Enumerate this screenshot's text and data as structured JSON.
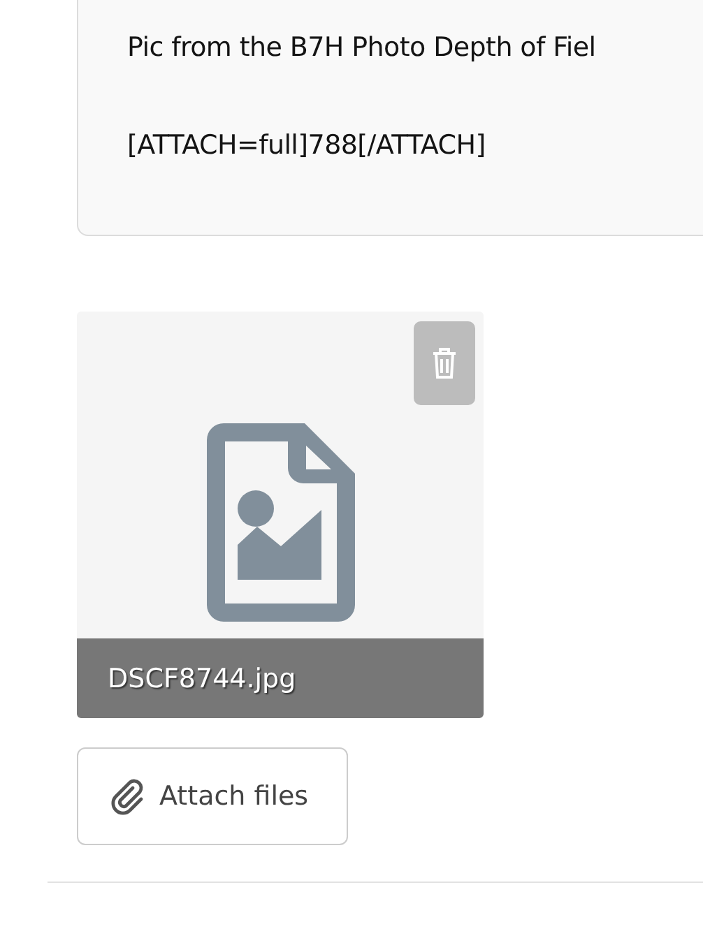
{
  "editor": {
    "lines": [
      "Pic from the B7H Photo Depth of Fiel",
      "[ATTACH=full]788[/ATTACH]"
    ]
  },
  "attachments": [
    {
      "kind": "picture",
      "filename": "DSCF8744.jpg"
    }
  ],
  "attach_button": {
    "label": "Attach files"
  }
}
